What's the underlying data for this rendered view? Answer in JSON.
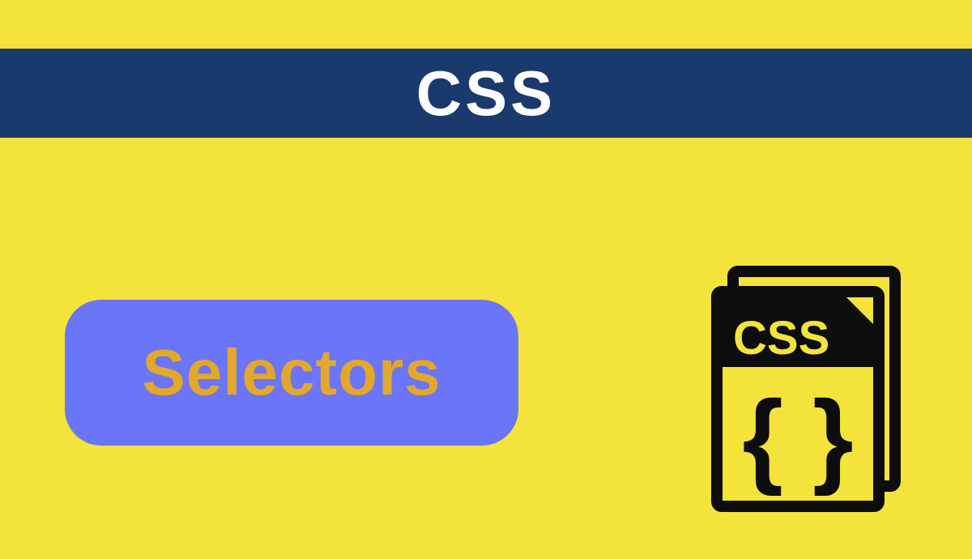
{
  "header": {
    "title": "CSS"
  },
  "topic": {
    "label": "Selectors"
  },
  "icon": {
    "label": "CSS"
  },
  "colors": {
    "background": "#f3e33b",
    "band": "#1a3a6e",
    "pill": "#6b75f8",
    "accent": "#e3a82b",
    "iconStroke": "#0d0d0d"
  }
}
